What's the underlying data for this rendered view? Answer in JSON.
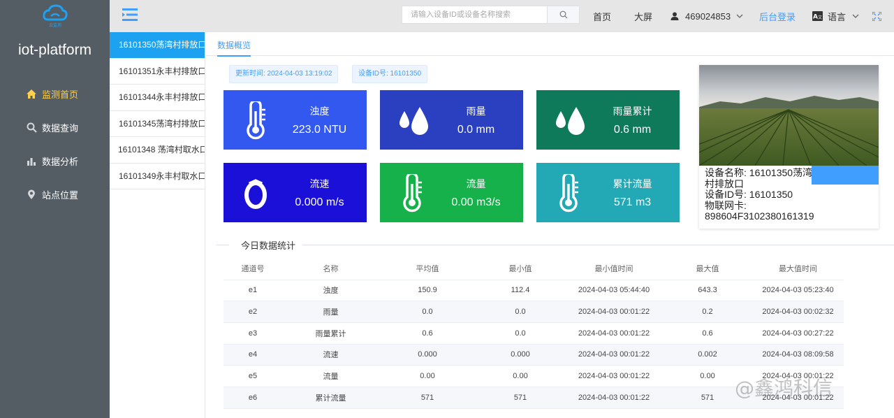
{
  "app": {
    "title": "iot-platform",
    "logo_caption": "云监测"
  },
  "sidebar": {
    "items": [
      {
        "label": "监测首页",
        "icon": "home-icon",
        "active": true
      },
      {
        "label": "数据查询",
        "icon": "search-icon"
      },
      {
        "label": "数据分析",
        "icon": "bar-chart-icon"
      },
      {
        "label": "站点位置",
        "icon": "location-pin-icon"
      }
    ]
  },
  "header": {
    "search_placeholder": "请输入设备ID或设备名称搜索",
    "nav_home": "首页",
    "nav_bigscreen": "大屏",
    "user": "469024853",
    "admin_login": "后台登录",
    "language": "语言"
  },
  "devices": [
    {
      "label": "16101350荡湾村排放口",
      "active": true
    },
    {
      "label": "16101351永丰村排放口"
    },
    {
      "label": "16101344永丰村排放口"
    },
    {
      "label": "16101345荡湾村排放口"
    },
    {
      "label": "16101348 荡湾村取水口"
    },
    {
      "label": "16101349永丰村取水口"
    }
  ],
  "main": {
    "tab": "数据概览",
    "update_time": "更新时间: 2024-04-03 13:19:02",
    "device_id_chip": "设备ID号: 16101350",
    "cards": [
      {
        "label": "浊度",
        "value": "223.0 NTU",
        "icon": "thermometer-icon",
        "color": "#3258f0"
      },
      {
        "label": "雨量",
        "value": "0.0 mm",
        "icon": "water-drops-icon",
        "color": "#2a40c0"
      },
      {
        "label": "雨量累计",
        "value": "0.6 mm",
        "icon": "water-drops-icon",
        "color": "#0e7a5a"
      },
      {
        "label": "流速",
        "value": "0.000 m/s",
        "icon": "ring-icon",
        "color": "#1b10d8"
      },
      {
        "label": "流量",
        "value": "0.00 m3/s",
        "icon": "thermometer-icon",
        "color": "#16b14a"
      },
      {
        "label": "累计流量",
        "value": "571 m3",
        "icon": "thermometer-icon",
        "color": "#22a9b5"
      }
    ],
    "device_info": {
      "name": "设备名称: 16101350荡湾",
      "name_cont": "村排放口",
      "id": "设备ID号: 16101350",
      "sim_label": "物联网卡:",
      "sim": "898604F3102380161319"
    },
    "stats": {
      "title": "今日数据统计",
      "columns": [
        "通道号",
        "名称",
        "平均值",
        "最小值",
        "最小值时间",
        "最大值",
        "最大值时间"
      ],
      "rows": [
        [
          "e1",
          "浊度",
          "150.9",
          "112.4",
          "2024-04-03 05:44:40",
          "643.3",
          "2024-04-03 05:23:40"
        ],
        [
          "e2",
          "雨量",
          "0.0",
          "0.0",
          "2024-04-03 00:01:22",
          "0.2",
          "2024-04-03 00:02:32"
        ],
        [
          "e3",
          "雨量累计",
          "0.6",
          "0.0",
          "2024-04-03 00:01:22",
          "0.6",
          "2024-04-03 00:27:22"
        ],
        [
          "e4",
          "流速",
          "0.000",
          "0.000",
          "2024-04-03 00:01:22",
          "0.002",
          "2024-04-03 08:09:58"
        ],
        [
          "e5",
          "流量",
          "0.00",
          "0.00",
          "2024-04-03 00:01:22",
          "0.00",
          "2024-04-03 00:01:22"
        ],
        [
          "e6",
          "累计流量",
          "571",
          "571",
          "2024-04-03 00:01:22",
          "571",
          "2024-04-03 00:01:22"
        ]
      ]
    }
  },
  "watermark": "@鑫鸿科信"
}
